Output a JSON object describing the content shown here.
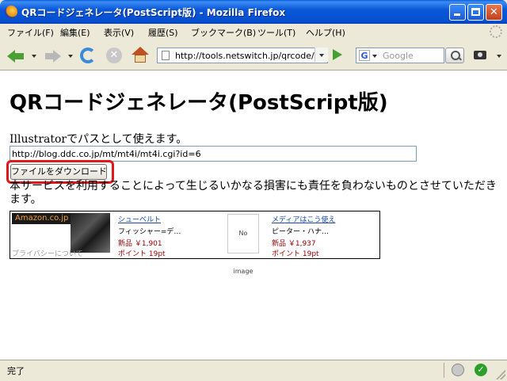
{
  "window": {
    "title": "QRコードジェネレータ(PostScript版) - Mozilla Firefox"
  },
  "menu": {
    "items": [
      "ファイル(F)",
      "編集(E)",
      "表示(V)",
      "履歴(S)",
      "ブックマーク(B)",
      "ツール(T)",
      "ヘルプ(H)"
    ]
  },
  "nav": {
    "url": "http://tools.netswitch.jp/qrcode/",
    "search_placeholder": "Google",
    "search_engine_letter": "G"
  },
  "page": {
    "heading": "QRコードジェネレータ(PostScript版)",
    "intro": "Illustratorでパスとして使えます。",
    "source_url_value": "http://blog.ddc.co.jp/mt/mt4i/mt4i.cgi?id=6",
    "download_label": "ファイルをダウンロード",
    "disclaimer": "本サービスを利用することによって生じるいかなる損害にも責任を負わないものとさせていただきます。"
  },
  "ad": {
    "header": "Amazon.co.jp",
    "privacy": "プライバシーについて",
    "no_image": "No image",
    "products": [
      {
        "title": "シューベルト",
        "artist": "フィッシャー=デ…",
        "price": "新品 ￥1,901",
        "points": "ポイント 19pt"
      },
      {
        "title": "メディアはこう使え",
        "artist": "ピーター・ハナ…",
        "price": "新品 ￥1,937",
        "points": "ポイント 19pt"
      }
    ]
  },
  "status": {
    "text": "完了"
  },
  "colors": {
    "highlight": "#e01818",
    "title_bar": "#0a58d8"
  }
}
